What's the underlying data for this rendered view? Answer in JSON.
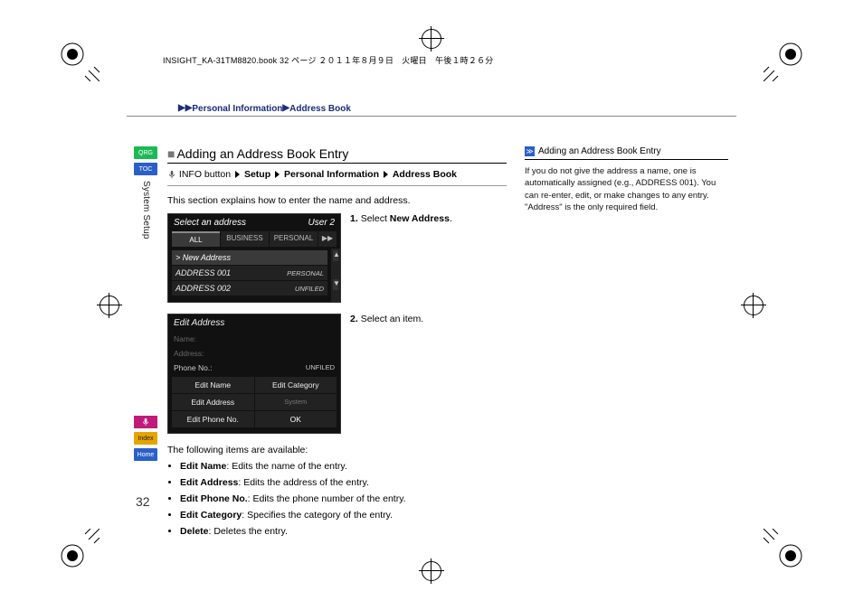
{
  "header_strip": "INSIGHT_KA-31TM8820.book  32 ページ  ２０１１年８月９日　火曜日　午後１時２６分",
  "breadcrumb": {
    "a": "Personal Information",
    "b": "Address Book"
  },
  "side": {
    "qrg": "QRG",
    "toc": "TOC",
    "section": "System Setup",
    "index": "Index",
    "home": "Home"
  },
  "title": "Adding an Address Book Entry",
  "nav": {
    "info": "INFO button",
    "setup": "Setup",
    "pi": "Personal Information",
    "ab": "Address Book"
  },
  "intro": "This section explains how to enter the name and address.",
  "shot1": {
    "title": "Select an address",
    "user": "User 2",
    "tabs": {
      "all": "ALL",
      "biz": "BUSINESS",
      "per": "PERSONAL",
      "more": "▶▶"
    },
    "rows": [
      {
        "label": "> New Address",
        "tag": ""
      },
      {
        "label": "ADDRESS 001",
        "tag": "PERSONAL"
      },
      {
        "label": "ADDRESS 002",
        "tag": "UNFILED"
      }
    ]
  },
  "step1": {
    "num": "1.",
    "pre": "Select ",
    "bold": "New Address",
    "post": "."
  },
  "shot2": {
    "title": "Edit Address",
    "fields": {
      "name": "Name:",
      "addr": "Address:",
      "phone": "Phone No.:",
      "phone_v": "UNFILED"
    },
    "cells": {
      "ename": "Edit Name",
      "ecat": "Edit Category",
      "eaddr": "Edit Address",
      "sys": "System",
      "ephone": "Edit Phone No.",
      "ok": "OK"
    }
  },
  "step2": {
    "num": "2.",
    "text": "Select an item."
  },
  "avail_intro": "The following items are available:",
  "avail": [
    {
      "b": "Edit Name",
      "t": ": Edits the name of the entry."
    },
    {
      "b": "Edit Address",
      "t": ": Edits the address of the entry."
    },
    {
      "b": "Edit Phone No.",
      "t": ": Edits the phone number of the entry."
    },
    {
      "b": "Edit Category",
      "t": ": Specifies the category of the entry."
    },
    {
      "b": "Delete",
      "t": ": Deletes the entry."
    }
  ],
  "right": {
    "head": "Adding an Address Book Entry",
    "body": "If you do not give the address a name, one is automatically assigned (e.g., ADDRESS 001). You can re-enter, edit, or make changes to any entry. \"Address\" is the only required field."
  },
  "page_num": "32"
}
